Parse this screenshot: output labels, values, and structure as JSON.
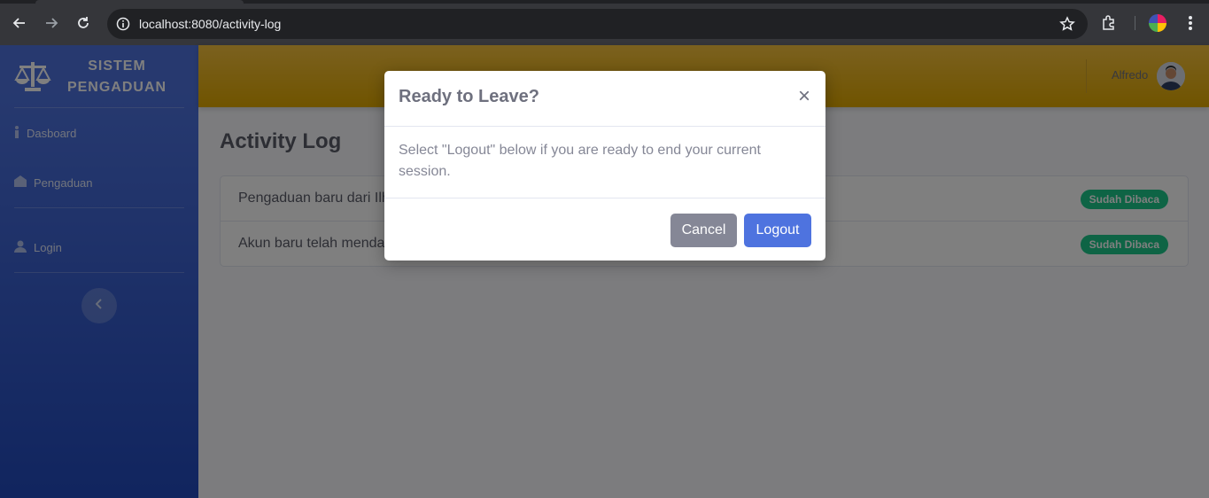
{
  "browser": {
    "url": "localhost:8080/activity-log"
  },
  "sidebar": {
    "brand_line1": "SISTEM",
    "brand_line2": "PENGADUAN",
    "items": [
      {
        "label": "Dasboard",
        "icon": "info-icon"
      },
      {
        "label": "Pengaduan",
        "icon": "home-icon"
      },
      {
        "label": "Login",
        "icon": "user-icon"
      }
    ]
  },
  "topbar": {
    "user_name": "Alfredo"
  },
  "main": {
    "title": "Activity Log",
    "logs": [
      {
        "text": "Pengaduan baru dari Ilham",
        "status": "Sudah Dibaca"
      },
      {
        "text": "Akun baru telah mendaftar",
        "status": "Sudah Dibaca"
      }
    ]
  },
  "modal": {
    "title": "Ready to Leave?",
    "close_glyph": "×",
    "body": "Select \"Logout\" below if you are ready to end your current session.",
    "cancel_label": "Cancel",
    "logout_label": "Logout"
  },
  "colors": {
    "sidebar": "#4e73df",
    "topbar": "#f6c23e",
    "badge": "#1cc88a",
    "primary": "#4e73df",
    "secondary": "#858796"
  }
}
